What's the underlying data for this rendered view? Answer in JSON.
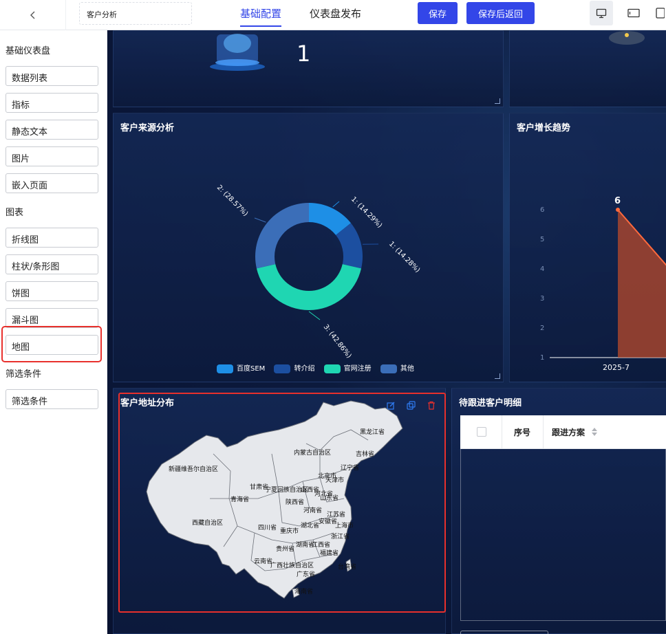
{
  "header": {
    "title_value": "客户分析",
    "tabs": [
      {
        "label": "基础配置"
      },
      {
        "label": "仪表盘发布"
      }
    ],
    "save_label": "保存",
    "save_return_label": "保存后返回"
  },
  "sidebar": {
    "sections": [
      {
        "title": "基础仪表盘",
        "items": [
          "数据列表",
          "指标",
          "静态文本",
          "图片",
          "嵌入页面"
        ]
      },
      {
        "title": "图表",
        "items": [
          "折线图",
          "柱状/条形图",
          "饼图",
          "漏斗图",
          "地图"
        ]
      },
      {
        "title": "筛选条件",
        "items": [
          "筛选条件"
        ]
      }
    ]
  },
  "widgets": {
    "metric_value": "1",
    "source_title": "客户来源分析",
    "growth_title": "客户增长趋势",
    "map_title": "客户地址分布",
    "table_title": "待跟进客户明细",
    "table_headers": [
      "序号",
      "跟进方案"
    ]
  },
  "chart_data": [
    {
      "type": "pie",
      "title": "客户来源分析",
      "slices": [
        {
          "name": "百度SEM",
          "value": 1,
          "label": "1: (14.29%)",
          "color": "#1e8fe6"
        },
        {
          "name": "转介绍",
          "value": 1,
          "label": "1: (14.28%)",
          "color": "#1c4fa0"
        },
        {
          "name": "官网注册",
          "value": 3,
          "label": "3: (42.86%)",
          "color": "#1fd6b2"
        },
        {
          "name": "其他",
          "value": 2,
          "label": "2: (28.57%)",
          "color": "#3b6eb8"
        }
      ],
      "legend": [
        "百度SEM",
        "转介绍",
        "官网注册",
        "其他"
      ]
    },
    {
      "type": "area",
      "title": "客户增长趋势",
      "categories": [
        "2025-7"
      ],
      "values": [
        6
      ],
      "yticks": [
        1,
        2,
        3,
        4,
        5,
        6
      ],
      "data_label": "6"
    }
  ],
  "map": {
    "provinces": [
      "黑龙江省",
      "内蒙古自治区",
      "吉林省",
      "新疆维吾尔自治区",
      "辽宁省",
      "甘肃省",
      "宁夏回族自治区",
      "山西省",
      "北京市",
      "天津市",
      "河北省",
      "青海省",
      "陕西省",
      "山东省",
      "河南省",
      "西藏自治区",
      "四川省",
      "江苏省",
      "安徽省",
      "上海市",
      "湖北省",
      "重庆市",
      "浙江省",
      "贵州省",
      "湖南省",
      "江西省",
      "福建省",
      "云南省",
      "广西壮族自治区",
      "广东省",
      "台湾省",
      "海南省"
    ]
  },
  "icons": [
    "back-chevron-icon",
    "desktop-icon",
    "tablet-icon",
    "mobile-icon",
    "edit-icon",
    "copy-icon",
    "delete-icon",
    "sort-icon"
  ],
  "colors": {
    "accent": "#3346e8",
    "highlight": "#e8302c",
    "canvas": "#0c1a3d"
  }
}
